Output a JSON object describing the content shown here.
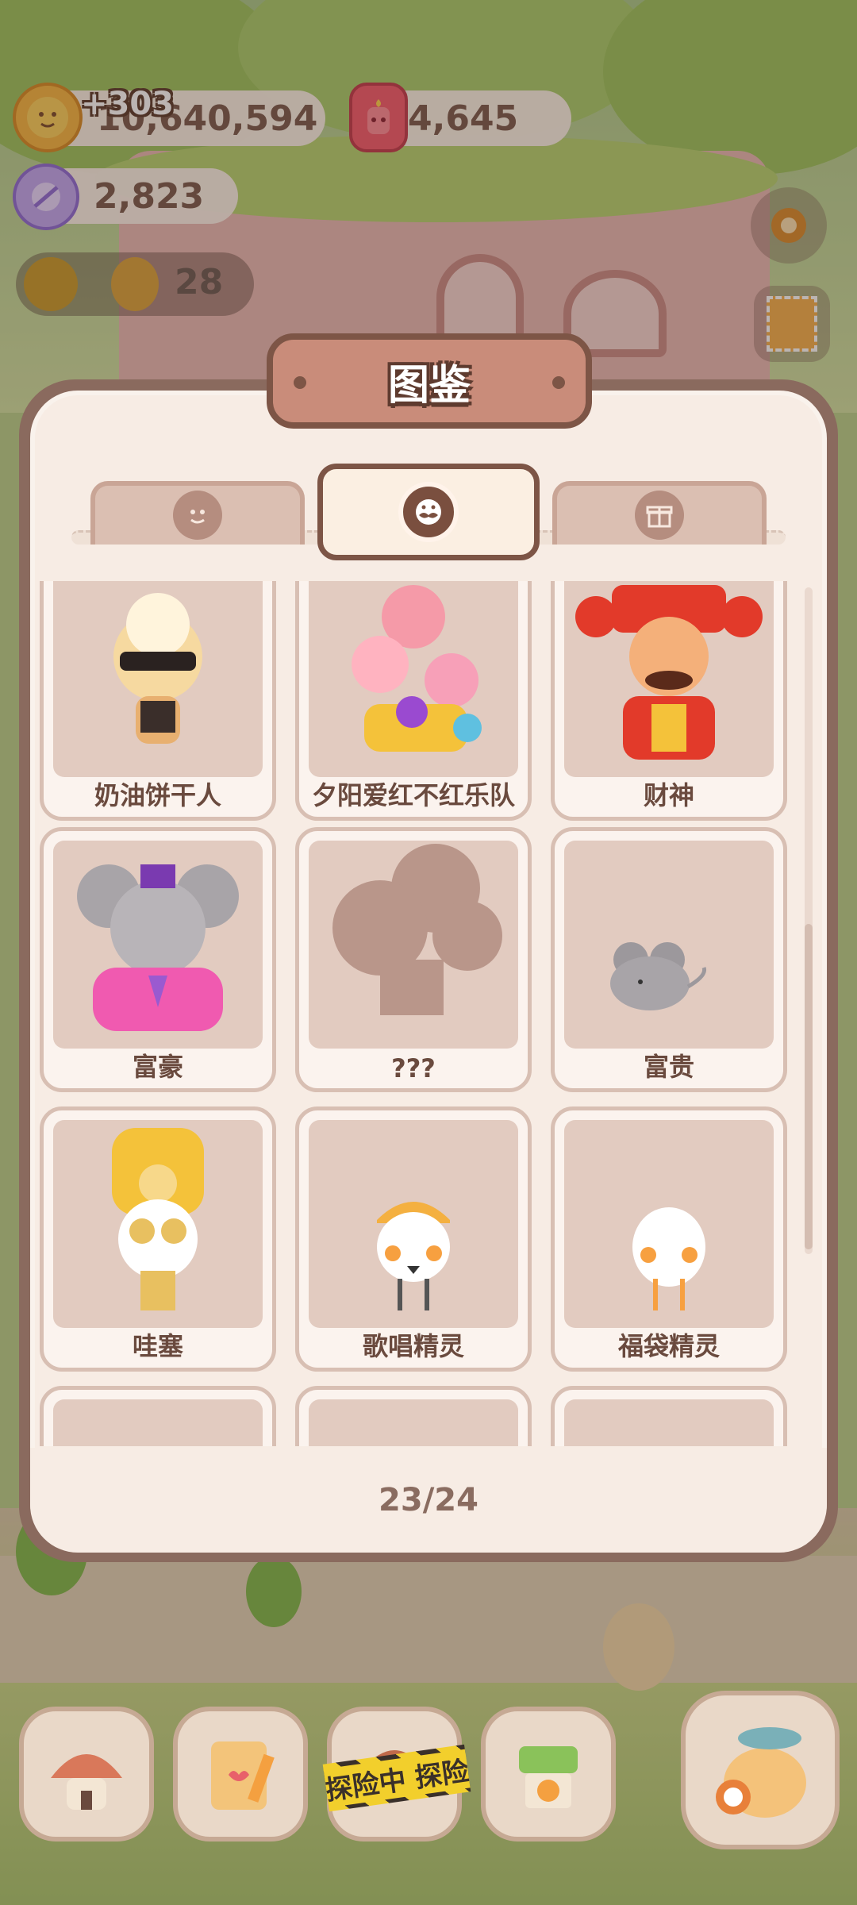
{
  "hud": {
    "coins": {
      "icon": "cookie-coin-icon",
      "value": "10,640,594",
      "gain": "+303"
    },
    "gems": {
      "icon": "candle-gem-icon",
      "value": "4,645"
    },
    "candy": {
      "icon": "candy-icon",
      "value": "2,823"
    },
    "sun_count": "28"
  },
  "modal": {
    "title": "图鉴",
    "tabs": [
      {
        "icon": "cookie-face-icon",
        "active": false
      },
      {
        "icon": "mustache-character-icon",
        "active": true
      },
      {
        "icon": "gift-box-icon",
        "active": false
      }
    ],
    "cards": [
      {
        "name": "奶油饼干人",
        "unlocked": true
      },
      {
        "name": "夕阳爱红不红乐队",
        "unlocked": true
      },
      {
        "name": "财神",
        "unlocked": true
      },
      {
        "name": "富豪",
        "unlocked": true
      },
      {
        "name": "???",
        "unlocked": false
      },
      {
        "name": "富贵",
        "unlocked": true
      },
      {
        "name": "哇塞",
        "unlocked": true
      },
      {
        "name": "歌唱精灵",
        "unlocked": true
      },
      {
        "name": "福袋精灵",
        "unlocked": true
      }
    ],
    "progress": "23/24"
  },
  "bottom_nav": {
    "items": [
      "mushroom-house-icon",
      "diary-icon",
      "adventure-icon",
      "shop-icon",
      "fish-pouch-icon"
    ],
    "adventure_banner": "探险中 探险"
  },
  "colors": {
    "panel_border": "#8a6a5e",
    "panel_bg": "#f7ece4",
    "text_brown": "#6a4a3e"
  }
}
